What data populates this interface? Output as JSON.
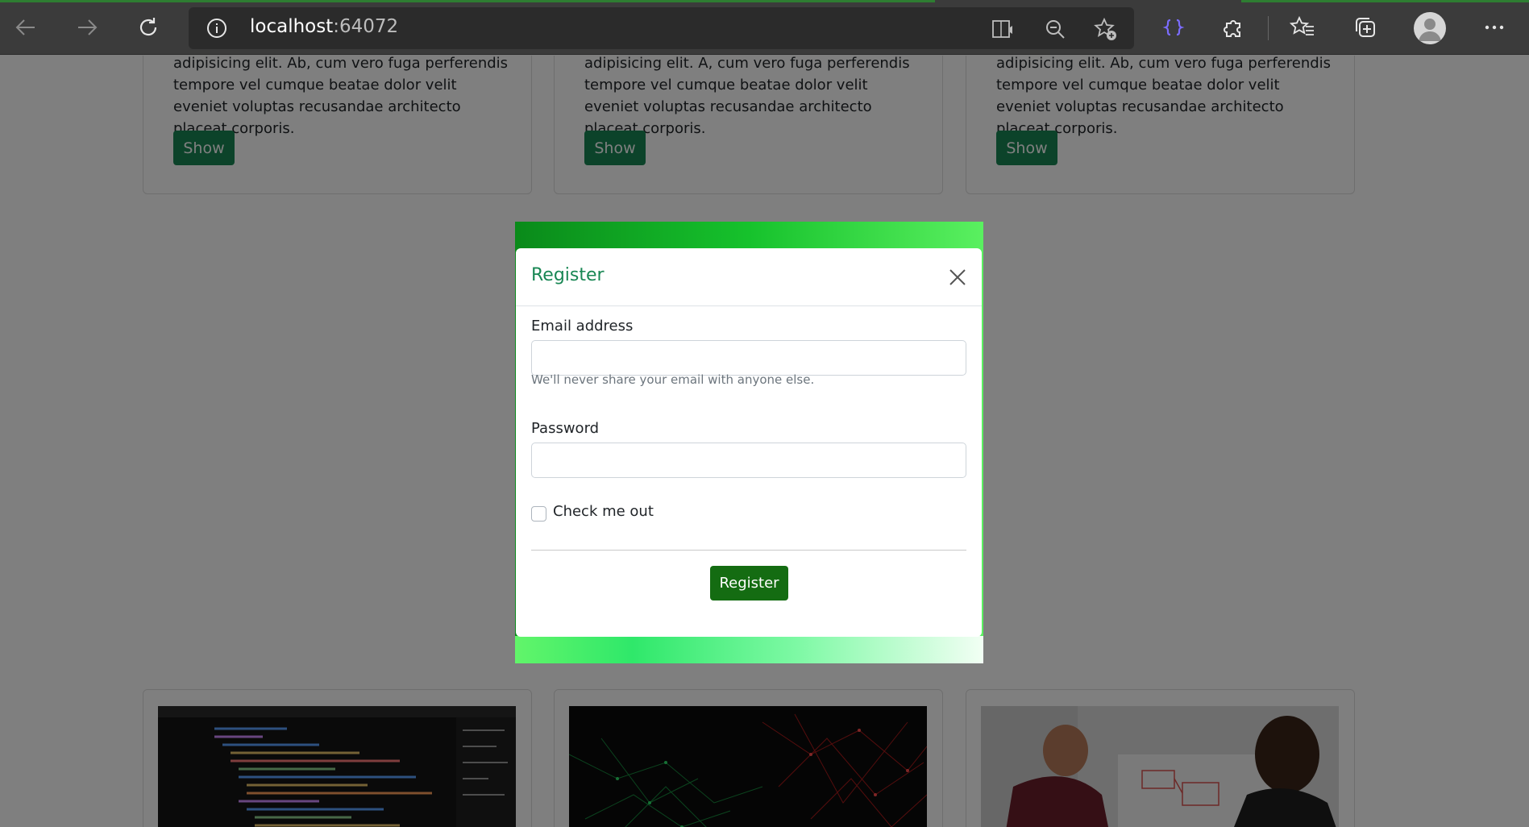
{
  "browser": {
    "url_host": "localhost",
    "url_port": ":64072",
    "back_icon": "back-arrow-icon",
    "forward_icon": "forward-arrow-icon",
    "refresh_icon": "refresh-icon"
  },
  "cards_top": [
    {
      "text": "adipisicing elit. Ab, cum vero fuga perferendis tempore vel cumque beatae dolor velit eveniet voluptas recusandae architecto placeat corporis.",
      "button": "Show"
    },
    {
      "text": "adipisicing elit. A, cum vero fuga perferendis tempore vel cumque beatae dolor velit eveniet voluptas recusandae architecto placeat corporis.",
      "button": "Show"
    },
    {
      "text": "adipisicing elit. Ab, cum vero fuga perferendis tempore vel cumque beatae dolor velit eveniet voluptas recusandae architecto placeat corporis.",
      "button": "Show"
    }
  ],
  "modal": {
    "title": "Register",
    "email_label": "Email address",
    "email_value": "",
    "email_help": "We'll never share your email with anyone else.",
    "password_label": "Password",
    "password_value": "",
    "check_label": "Check me out",
    "submit_label": "Register"
  },
  "colors": {
    "accent": "#198754",
    "submit": "#146c12"
  }
}
